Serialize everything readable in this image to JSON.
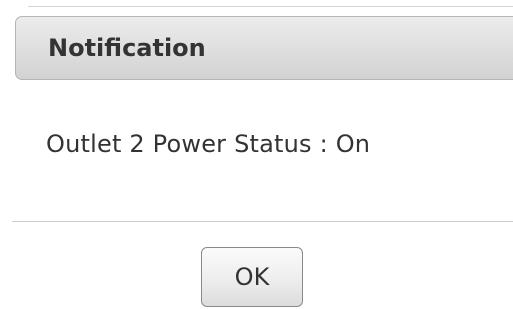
{
  "dialog": {
    "title": "Notification",
    "message": "Outlet 2 Power Status : On",
    "ok_label": "OK"
  }
}
